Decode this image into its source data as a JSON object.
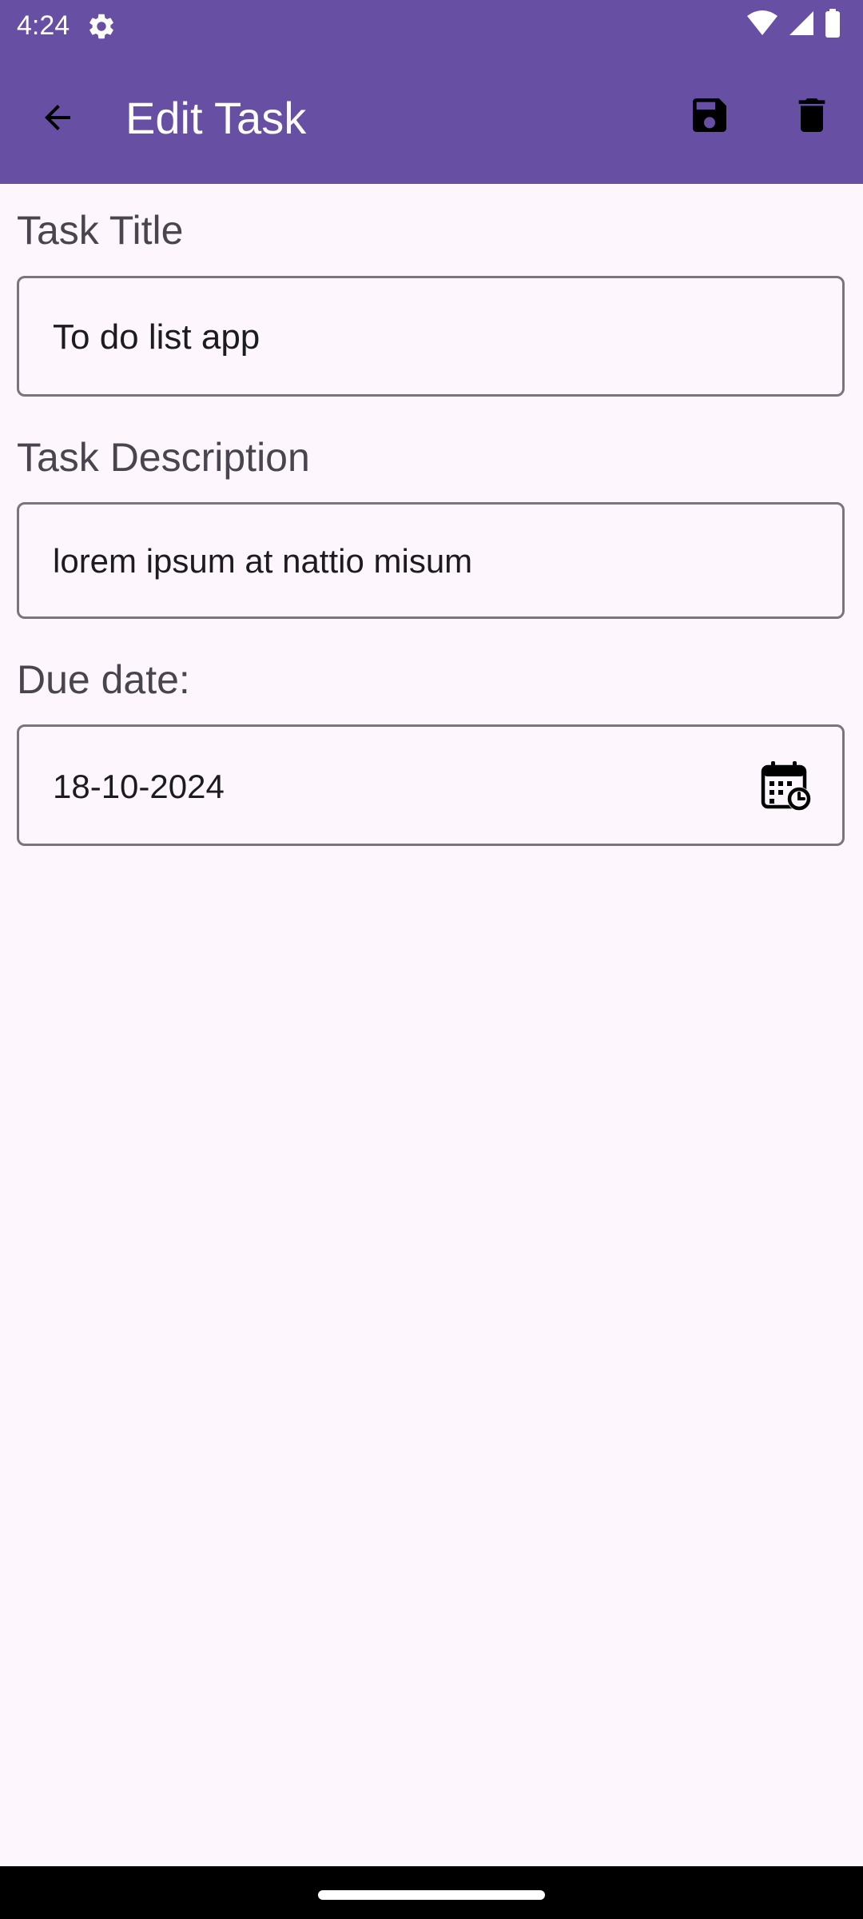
{
  "status_bar": {
    "time": "4:24",
    "icons": [
      "settings-icon",
      "wifi-icon",
      "signal-icon",
      "battery-icon"
    ]
  },
  "app_bar": {
    "title": "Edit Task",
    "color": "#6750a4",
    "icons": [
      "back-arrow-icon",
      "save-icon",
      "delete-icon"
    ]
  },
  "form": {
    "title_label": "Task Title",
    "title_value": "To do list app",
    "description_label": "Task Description",
    "description_value": "lorem ipsum at nattio misum",
    "due_date_label": "Due date:",
    "due_date_value": "18-10-2024",
    "due_date_icon": "calendar-clock-icon"
  },
  "colors": {
    "background": "#fdf7fd",
    "label": "#49454f",
    "outline": "#79747e"
  }
}
